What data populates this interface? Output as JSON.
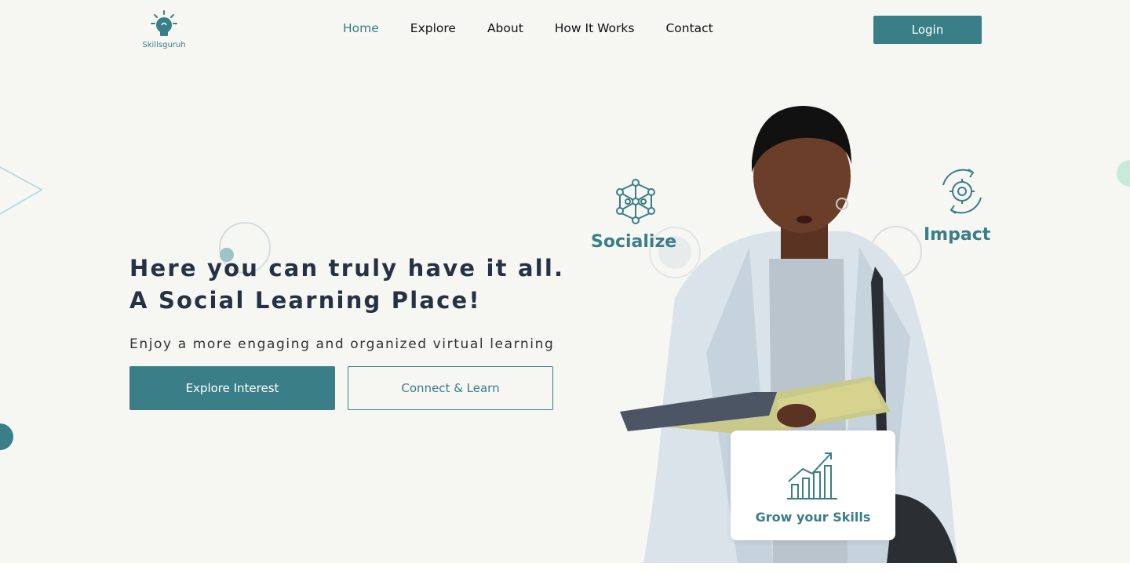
{
  "brand": {
    "name": "Skillsguruh",
    "accent": "#3a7e87"
  },
  "nav": {
    "items": [
      {
        "label": "Home",
        "active": true
      },
      {
        "label": "Explore",
        "active": false
      },
      {
        "label": "About",
        "active": false
      },
      {
        "label": "How It Works",
        "active": false
      },
      {
        "label": "Contact",
        "active": false
      }
    ],
    "login_label": "Login"
  },
  "hero": {
    "title": "Here you can truly have it all. A Social Learning Place!",
    "subtitle": "Enjoy a more engaging and organized virtual learning",
    "primary_button": "Explore Interest",
    "secondary_button": "Connect & Learn"
  },
  "features": {
    "socialize": {
      "label": "Socialize",
      "icon": "network-nodes-icon"
    },
    "impact": {
      "label": "Impact",
      "icon": "gear-cycle-icon"
    },
    "grow": {
      "label": "Grow your Skills",
      "icon": "growth-chart-icon"
    }
  }
}
